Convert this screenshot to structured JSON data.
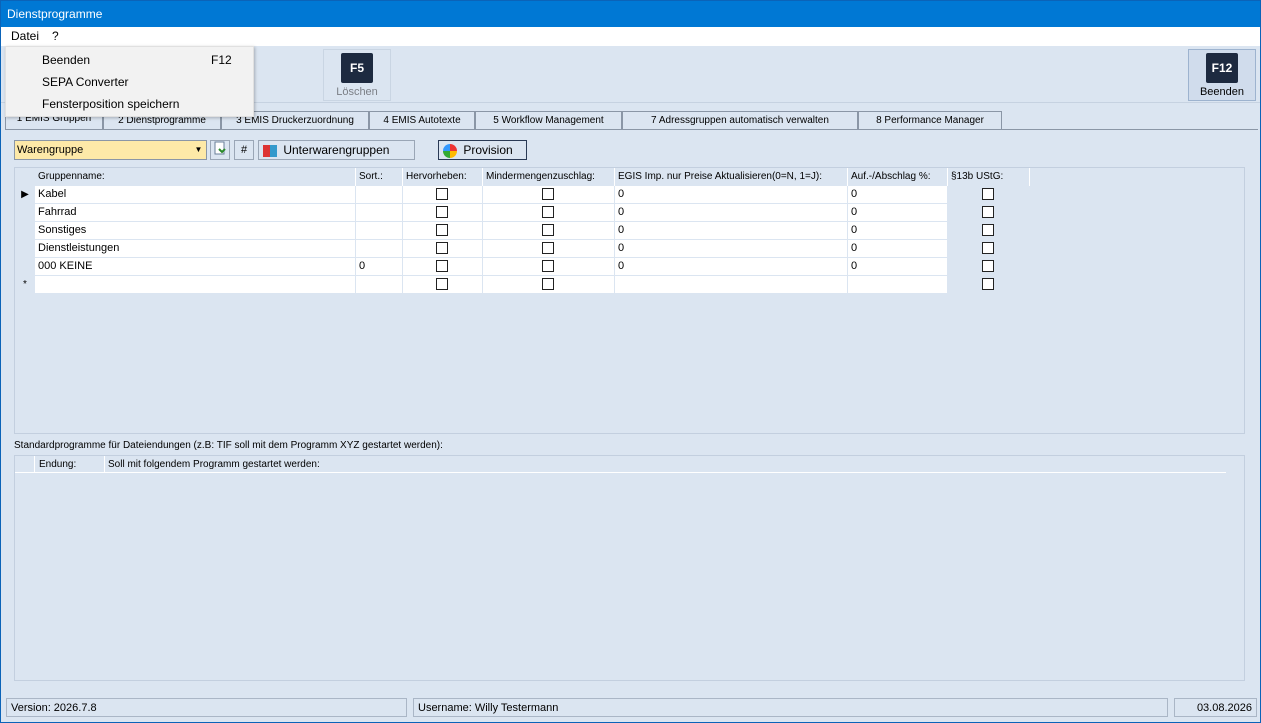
{
  "window": {
    "title": "Dienstprogramme"
  },
  "menubar": {
    "file": "Datei",
    "help": "?"
  },
  "file_menu": {
    "items": [
      {
        "label": "Beenden",
        "shortcut": "F12"
      },
      {
        "label": "SEPA Converter",
        "shortcut": ""
      },
      {
        "label": "Fensterposition speichern",
        "shortcut": ""
      }
    ]
  },
  "toolbar": {
    "delete": {
      "key": "F5",
      "label": "Löschen"
    },
    "exit": {
      "key": "F12",
      "label": "Beenden"
    }
  },
  "tabs": [
    "1 EMIS Gruppen",
    "2 Dienstprogramme",
    "3 EMIS Druckerzuordnung",
    "4 EMIS Autotexte",
    "5 Workflow Management",
    "7 Adressgruppen automatisch verwalten",
    "8 Performance Manager"
  ],
  "controls": {
    "group_select": "Warengruppe",
    "hash_label": "#",
    "subgroups_label": "Unterwarengruppen",
    "provision_label": "Provision"
  },
  "groups_table": {
    "columns": [
      "Gruppenname:",
      "Sort.:",
      "Hervorheben:",
      "Mindermengenzuschlag:",
      "EGIS Imp. nur Preise Aktualisieren(0=N, 1=J):",
      "Auf.-/Abschlag %:",
      "§13b UStG:"
    ],
    "rows": [
      {
        "name": "Kabel",
        "sort": "",
        "highlight": false,
        "minqty": false,
        "egis": "0",
        "markup": "0",
        "ustg": false
      },
      {
        "name": "Fahrrad",
        "sort": "",
        "highlight": false,
        "minqty": false,
        "egis": "0",
        "markup": "0",
        "ustg": false
      },
      {
        "name": "Sonstiges",
        "sort": "",
        "highlight": false,
        "minqty": false,
        "egis": "0",
        "markup": "0",
        "ustg": false
      },
      {
        "name": "Dienstleistungen",
        "sort": "",
        "highlight": false,
        "minqty": false,
        "egis": "0",
        "markup": "0",
        "ustg": false
      },
      {
        "name": "000 KEINE",
        "sort": "0",
        "highlight": false,
        "minqty": false,
        "egis": "0",
        "markup": "0",
        "ustg": false
      }
    ]
  },
  "extensions_section": {
    "label": "Standardprogramme für Dateiendungen (z.B: TIF soll mit dem Programm XYZ gestartet werden):",
    "columns": [
      "Endung:",
      "Soll mit folgendem Programm gestartet werden:"
    ]
  },
  "statusbar": {
    "version": "Version: 2026.7.8",
    "user": "Username: Willy Testermann",
    "date": "03.08.2026"
  },
  "colors": {
    "titlebar": "#0078d4",
    "panel": "#dbe5f1",
    "combo": "#fde9a8"
  }
}
